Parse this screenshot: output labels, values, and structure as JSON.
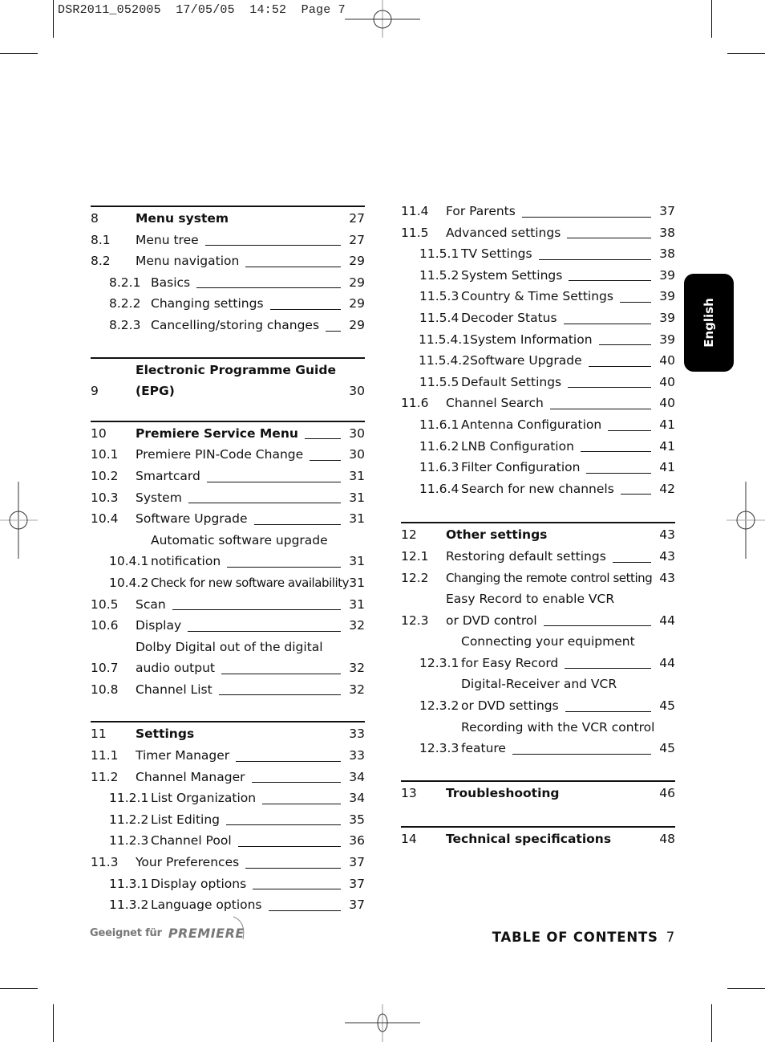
{
  "slug": "DSR2011_052005  17/05/05  14:52  Page 7",
  "language_tab": "English",
  "footer": {
    "logo_prefix": "Geeignet für",
    "logo_brand": "PREMIERE",
    "section_title": "TABLE OF CONTENTS",
    "page_number": "7"
  },
  "left_column": [
    {
      "num": "8",
      "title": "Menu system",
      "page": "27",
      "level": 1,
      "bold": true,
      "rule": true,
      "leader": false
    },
    {
      "num": "8.1",
      "title": "Menu tree",
      "page": "27",
      "level": 1
    },
    {
      "num": "8.2",
      "title": "Menu navigation",
      "page": "29",
      "level": 1
    },
    {
      "num": "8.2.1",
      "title": "Basics",
      "page": "29",
      "level": 2
    },
    {
      "num": "8.2.2",
      "title": "Changing settings",
      "page": "29",
      "level": 2
    },
    {
      "num": "8.2.3",
      "title": "Cancelling/storing changes",
      "page": "29",
      "level": 2
    },
    {
      "num": "9",
      "title": "Electronic Programme Guide",
      "title2": "(EPG)",
      "page": "30",
      "level": 1,
      "bold": true,
      "rule": true,
      "leader": false
    },
    {
      "num": "10",
      "title": "Premiere Service Menu",
      "page": "30",
      "level": 1,
      "bold": true,
      "rule": true
    },
    {
      "num": "10.1",
      "title": "Premiere PIN-Code Change",
      "page": "30",
      "level": 1
    },
    {
      "num": "10.2",
      "title": "Smartcard",
      "page": "31",
      "level": 1
    },
    {
      "num": "10.3",
      "title": "System",
      "page": "31",
      "level": 1
    },
    {
      "num": "10.4",
      "title": "Software Upgrade",
      "page": "31",
      "level": 1
    },
    {
      "num": "10.4.1",
      "title": "Automatic software upgrade",
      "title2": "notification",
      "page": "31",
      "level": 2
    },
    {
      "num": "10.4.2",
      "title": "Check for new software availability",
      "page": "31",
      "level": 2,
      "leader": false,
      "condensed": true
    },
    {
      "num": "10.5",
      "title": "Scan",
      "page": "31",
      "level": 1
    },
    {
      "num": "10.6",
      "title": "Display",
      "page": "32",
      "level": 1
    },
    {
      "num": "10.7",
      "title": "Dolby Digital out of the digital",
      "title2": "audio output",
      "page": "32",
      "level": 1
    },
    {
      "num": "10.8",
      "title": "Channel List",
      "page": "32",
      "level": 1
    },
    {
      "num": "11",
      "title": "Settings",
      "page": "33",
      "level": 1,
      "bold": true,
      "rule": true,
      "leader": false
    },
    {
      "num": "11.1",
      "title": "Timer Manager",
      "page": "33",
      "level": 1
    },
    {
      "num": "11.2",
      "title": "Channel Manager",
      "page": "34",
      "level": 1
    },
    {
      "num": "11.2.1",
      "title": "List Organization",
      "page": "34",
      "level": 2
    },
    {
      "num": "11.2.2",
      "title": "List Editing",
      "page": "35",
      "level": 2
    },
    {
      "num": "11.2.3",
      "title": "Channel Pool",
      "page": "36",
      "level": 2
    },
    {
      "num": "11.3",
      "title": "Your Preferences",
      "page": "37",
      "level": 1
    },
    {
      "num": "11.3.1",
      "title": "Display options",
      "page": "37",
      "level": 2
    },
    {
      "num": "11.3.2",
      "title": "Language options",
      "page": "37",
      "level": 2
    }
  ],
  "right_column": [
    {
      "num": "11.4",
      "title": "For Parents",
      "page": "37",
      "level": 1
    },
    {
      "num": "11.5",
      "title": "Advanced settings",
      "page": "38",
      "level": 1
    },
    {
      "num": "11.5.1",
      "title": "TV Settings",
      "page": "38",
      "level": 2
    },
    {
      "num": "11.5.2",
      "title": "System Settings",
      "page": "39",
      "level": 2
    },
    {
      "num": "11.5.3",
      "title": "Country & Time Settings",
      "page": "39",
      "level": 2
    },
    {
      "num": "11.5.4",
      "title": "Decoder Status",
      "page": "39",
      "level": 2
    },
    {
      "num": "11.5.4.1",
      "title": "System Information",
      "page": "39",
      "level": 3
    },
    {
      "num": "11.5.4.2",
      "title": "Software Upgrade",
      "page": "40",
      "level": 3
    },
    {
      "num": "11.5.5",
      "title": "Default Settings",
      "page": "40",
      "level": 2
    },
    {
      "num": "11.6",
      "title": "Channel Search",
      "page": "40",
      "level": 1
    },
    {
      "num": "11.6.1",
      "title": "Antenna Configuration",
      "page": "41",
      "level": 2
    },
    {
      "num": "11.6.2",
      "title": "LNB Configuration",
      "page": "41",
      "level": 2
    },
    {
      "num": "11.6.3",
      "title": "Filter Configuration",
      "page": "41",
      "level": 2
    },
    {
      "num": "11.6.4",
      "title": "Search for new channels",
      "page": "42",
      "level": 2
    },
    {
      "num": "12",
      "title": "Other settings",
      "page": "43",
      "level": 1,
      "bold": true,
      "rule": true,
      "leader": false
    },
    {
      "num": "12.1",
      "title": "Restoring default settings",
      "page": "43",
      "level": 1
    },
    {
      "num": "12.2",
      "title": "Changing the remote control setting",
      "page": "43",
      "level": 1,
      "leader": false,
      "condensed": true
    },
    {
      "num": "12.3",
      "title": "Easy Record to enable VCR",
      "title2": "or DVD control",
      "page": "44",
      "level": 1
    },
    {
      "num": "12.3.1",
      "title": "Connecting your equipment",
      "title2": "for Easy Record",
      "page": "44",
      "level": 2
    },
    {
      "num": "12.3.2",
      "title": "Digital-Receiver and VCR",
      "title2": "or DVD settings",
      "page": "45",
      "level": 2
    },
    {
      "num": "12.3.3",
      "title": "Recording with the VCR control",
      "title2": "feature",
      "page": "45",
      "level": 2
    },
    {
      "num": "13",
      "title": "Troubleshooting",
      "page": "46",
      "level": 1,
      "bold": true,
      "rule": true,
      "leader": false
    },
    {
      "num": "14",
      "title": "Technical specifications",
      "page": "48",
      "level": 1,
      "bold": true,
      "rule": true,
      "leader": false
    }
  ]
}
